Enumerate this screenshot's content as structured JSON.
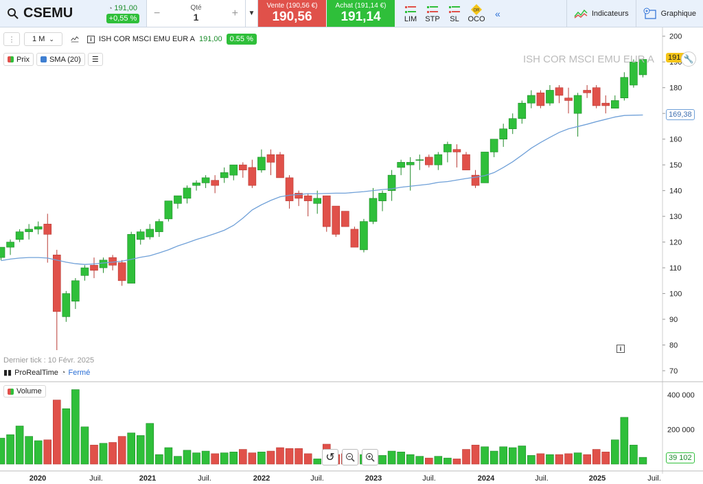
{
  "header": {
    "symbol": "CSEMU",
    "price": "191,00",
    "change": "+0,55 %",
    "qty_label": "Qté",
    "qty_value": "1",
    "sell_label": "Vente (190,56 €)",
    "sell_price": "190,56",
    "buy_label": "Achat (191,14 €)",
    "buy_price": "191,14",
    "order_types": [
      "LIM",
      "STP",
      "SL",
      "OCO"
    ],
    "oco_badge": "OR",
    "indicators": "Indicateurs",
    "graph": "Graphique"
  },
  "toolbar": {
    "interval": "1 M",
    "instrument": "ISH COR MSCI EMU EUR A",
    "price": "191,00",
    "change": "0.55 %"
  },
  "legend": {
    "price": "Prix",
    "sma": "SMA (20)",
    "volume": "Volume"
  },
  "status": {
    "last_tick": "Dernier tick : 10 Févr. 2025",
    "provider": "ProRealTime",
    "state": "Fermé"
  },
  "watermark": "ISH COR MSCI EMU EUR A",
  "tags": {
    "price": "191,00",
    "sma": "169,38",
    "volume": "39 102"
  },
  "colors": {
    "up": "#2fbf3a",
    "down": "#e0514a",
    "sma": "#6fa0d8"
  },
  "chart_data": {
    "type": "candlestick",
    "interval": "monthly",
    "ylim": [
      66,
      201
    ],
    "yticks": [
      70,
      80,
      90,
      100,
      110,
      120,
      130,
      140,
      150,
      160,
      170,
      180,
      190,
      200
    ],
    "volume_ticks": [
      200000,
      400000
    ],
    "volume_tick_labels": [
      "200 000",
      "400 000"
    ],
    "x_labels": [
      "2020",
      "Juil.",
      "2021",
      "Juil.",
      "2022",
      "Juil.",
      "2023",
      "Juil.",
      "2024",
      "Juil.",
      "2025",
      "Juil."
    ],
    "sma_last": 169.38,
    "candles": [
      {
        "o": 114,
        "h": 118,
        "l": 113,
        "c": 118,
        "v": 150000
      },
      {
        "o": 118,
        "h": 121,
        "l": 115,
        "c": 120,
        "v": 170000
      },
      {
        "o": 121,
        "h": 125,
        "l": 120,
        "c": 124,
        "v": 220000
      },
      {
        "o": 124,
        "h": 127,
        "l": 121,
        "c": 125,
        "v": 160000
      },
      {
        "o": 125,
        "h": 128,
        "l": 123,
        "c": 126,
        "v": 135000
      },
      {
        "o": 127,
        "h": 131,
        "l": 112,
        "c": 123,
        "v": 140000
      },
      {
        "o": 115,
        "h": 117,
        "l": 78,
        "c": 93,
        "v": 370000
      },
      {
        "o": 91,
        "h": 101,
        "l": 89,
        "c": 100,
        "v": 320000
      },
      {
        "o": 97,
        "h": 106,
        "l": 94,
        "c": 105,
        "v": 430000
      },
      {
        "o": 107,
        "h": 111,
        "l": 105,
        "c": 110,
        "v": 215000
      },
      {
        "o": 111,
        "h": 114,
        "l": 106,
        "c": 109,
        "v": 110000
      },
      {
        "o": 110,
        "h": 114,
        "l": 108,
        "c": 113,
        "v": 120000
      },
      {
        "o": 114,
        "h": 115,
        "l": 109,
        "c": 111,
        "v": 125000
      },
      {
        "o": 112,
        "h": 113,
        "l": 103,
        "c": 105,
        "v": 160000
      },
      {
        "o": 104,
        "h": 124,
        "l": 104,
        "c": 123,
        "v": 180000
      },
      {
        "o": 121,
        "h": 125,
        "l": 119,
        "c": 124,
        "v": 165000
      },
      {
        "o": 122,
        "h": 127,
        "l": 121,
        "c": 125,
        "v": 235000
      },
      {
        "o": 124,
        "h": 129,
        "l": 122,
        "c": 128,
        "v": 55000
      },
      {
        "o": 129,
        "h": 136,
        "l": 128,
        "c": 136,
        "v": 95000
      },
      {
        "o": 135,
        "h": 138,
        "l": 133,
        "c": 138,
        "v": 45000
      },
      {
        "o": 137,
        "h": 142,
        "l": 135,
        "c": 141,
        "v": 80000
      },
      {
        "o": 142,
        "h": 144,
        "l": 140,
        "c": 143,
        "v": 65000
      },
      {
        "o": 143,
        "h": 146,
        "l": 141,
        "c": 145,
        "v": 75000
      },
      {
        "o": 144,
        "h": 146,
        "l": 139,
        "c": 142,
        "v": 60000
      },
      {
        "o": 145,
        "h": 149,
        "l": 143,
        "c": 147,
        "v": 65000
      },
      {
        "o": 146,
        "h": 150,
        "l": 144,
        "c": 150,
        "v": 70000
      },
      {
        "o": 150,
        "h": 151,
        "l": 145,
        "c": 148,
        "v": 85000
      },
      {
        "o": 149,
        "h": 152,
        "l": 141,
        "c": 142,
        "v": 65000
      },
      {
        "o": 148,
        "h": 156,
        "l": 147,
        "c": 153,
        "v": 70000
      },
      {
        "o": 154,
        "h": 156,
        "l": 146,
        "c": 151,
        "v": 75000
      },
      {
        "o": 154,
        "h": 155,
        "l": 145,
        "c": 145,
        "v": 95000
      },
      {
        "o": 145,
        "h": 146,
        "l": 133,
        "c": 136,
        "v": 90000
      },
      {
        "o": 139,
        "h": 140,
        "l": 134,
        "c": 137,
        "v": 90000
      },
      {
        "o": 138,
        "h": 139,
        "l": 130,
        "c": 136,
        "v": 60000
      },
      {
        "o": 135,
        "h": 140,
        "l": 131,
        "c": 137,
        "v": 30000
      },
      {
        "o": 138,
        "h": 138,
        "l": 124,
        "c": 126,
        "v": 115000
      },
      {
        "o": 134,
        "h": 134,
        "l": 122,
        "c": 123,
        "v": 55000
      },
      {
        "o": 132,
        "h": 132,
        "l": 126,
        "c": 126,
        "v": 60000
      },
      {
        "o": 125,
        "h": 126,
        "l": 119,
        "c": 118,
        "v": 65000
      },
      {
        "o": 117,
        "h": 129,
        "l": 116,
        "c": 128,
        "v": 55000
      },
      {
        "o": 128,
        "h": 141,
        "l": 127,
        "c": 137,
        "v": 60000
      },
      {
        "o": 136,
        "h": 140,
        "l": 132,
        "c": 139,
        "v": 50000
      },
      {
        "o": 140,
        "h": 148,
        "l": 136,
        "c": 146,
        "v": 75000
      },
      {
        "o": 149,
        "h": 152,
        "l": 146,
        "c": 151,
        "v": 70000
      },
      {
        "o": 150,
        "h": 153,
        "l": 140,
        "c": 151,
        "v": 55000
      },
      {
        "o": 152,
        "h": 154,
        "l": 148,
        "c": 152,
        "v": 45000
      },
      {
        "o": 153,
        "h": 154,
        "l": 149,
        "c": 150,
        "v": 35000
      },
      {
        "o": 150,
        "h": 155,
        "l": 148,
        "c": 154,
        "v": 45000
      },
      {
        "o": 155,
        "h": 159,
        "l": 151,
        "c": 158,
        "v": 35000
      },
      {
        "o": 156,
        "h": 158,
        "l": 149,
        "c": 155,
        "v": 30000
      },
      {
        "o": 154,
        "h": 155,
        "l": 149,
        "c": 148,
        "v": 85000
      },
      {
        "o": 146,
        "h": 148,
        "l": 141,
        "c": 142,
        "v": 110000
      },
      {
        "o": 143,
        "h": 155,
        "l": 143,
        "c": 155,
        "v": 100000
      },
      {
        "o": 155,
        "h": 160,
        "l": 153,
        "c": 160,
        "v": 75000
      },
      {
        "o": 160,
        "h": 166,
        "l": 157,
        "c": 164,
        "v": 100000
      },
      {
        "o": 164,
        "h": 170,
        "l": 162,
        "c": 168,
        "v": 95000
      },
      {
        "o": 168,
        "h": 175,
        "l": 166,
        "c": 174,
        "v": 105000
      },
      {
        "o": 174,
        "h": 179,
        "l": 172,
        "c": 177,
        "v": 50000
      },
      {
        "o": 178,
        "h": 179,
        "l": 172,
        "c": 173,
        "v": 60000
      },
      {
        "o": 174,
        "h": 181,
        "l": 173,
        "c": 179,
        "v": 55000
      },
      {
        "o": 180,
        "h": 181,
        "l": 174,
        "c": 177,
        "v": 55000
      },
      {
        "o": 176,
        "h": 180,
        "l": 170,
        "c": 175,
        "v": 60000
      },
      {
        "o": 170,
        "h": 178,
        "l": 161,
        "c": 177,
        "v": 65000
      },
      {
        "o": 179,
        "h": 181,
        "l": 176,
        "c": 178,
        "v": 55000
      },
      {
        "o": 180,
        "h": 181,
        "l": 172,
        "c": 173,
        "v": 85000
      },
      {
        "o": 174,
        "h": 177,
        "l": 170,
        "c": 173,
        "v": 70000
      },
      {
        "o": 172,
        "h": 177,
        "l": 172,
        "c": 175,
        "v": 140000
      },
      {
        "o": 176,
        "h": 186,
        "l": 175,
        "c": 184,
        "v": 270000
      },
      {
        "o": 181,
        "h": 191,
        "l": 180,
        "c": 190,
        "v": 110000
      },
      {
        "o": 185,
        "h": 191,
        "l": 184,
        "c": 191,
        "v": 39102
      }
    ],
    "sma": [
      112.8,
      113.4,
      113.8,
      114.0,
      114.0,
      113.8,
      113.0,
      112.2,
      111.6,
      111.3,
      111.5,
      111.9,
      112.2,
      112.6,
      113.3,
      114.1,
      114.7,
      115.8,
      117.0,
      118.5,
      119.7,
      121.0,
      122.1,
      123.3,
      124.6,
      126.5,
      129.3,
      132.5,
      134.5,
      136.2,
      137.6,
      138.2,
      138.5,
      138.8,
      138.8,
      138.9,
      139.0,
      139.0,
      139.3,
      139.6,
      140.0,
      140.4,
      140.7,
      141.3,
      141.7,
      142.1,
      142.5,
      143.2,
      143.5,
      144.1,
      144.7,
      145.2,
      145.8,
      147.0,
      149.0,
      151.2,
      153.8,
      156.5,
      158.7,
      160.7,
      162.6,
      164.0,
      164.9,
      165.8,
      166.8,
      167.7,
      168.6,
      169.2,
      169.3,
      169.38
    ]
  }
}
